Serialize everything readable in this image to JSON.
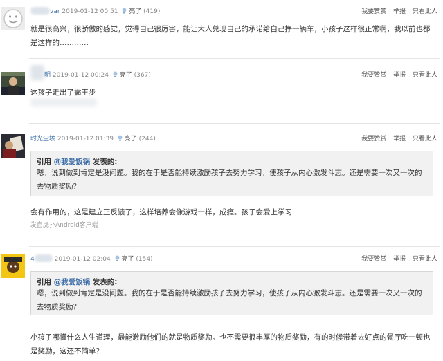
{
  "common": {
    "light_label": "亮了",
    "actions": [
      "我要赞赏",
      "举报",
      "只看此人"
    ],
    "quote_prefix": "引用 ",
    "quote_suffix": " 发表的:",
    "quote_ref_user": "@我爱饭锅"
  },
  "posts": [
    {
      "user": "var",
      "time": "2019-01-12 00:51",
      "likes": "(419)",
      "text": "就是很高兴，很骄傲的感觉，觉得自己很厉害，能让大人兑现自己的承诺给自己挣一辆车，小孩子这样很正常啊，我以前也都是这样的…………"
    },
    {
      "user": "明",
      "time": "2019-01-12 00:24",
      "likes": "(367)",
      "text": "这孩子走出了霸王步"
    },
    {
      "user": "时光尘埃",
      "time": "2019-01-12 01:39",
      "likes": "(244)",
      "quote_text": "嗯，说到做到肯定是没问题。我的在于是否能持续激励孩子去努力学习，使孩子从内心激发斗志。还是需要一次又一次的去物质奖励？",
      "text": "会有作用的，这是建立正反馈了，这样培养会像游戏一样，成瘾。孩子会爱上学习",
      "client": "发自虎扑Android客户端"
    },
    {
      "user": "4",
      "time": "2019-01-12 02:04",
      "likes": "(154)",
      "quote_text": "嗯，说到做到肯定是没问题。我的在于是否能持续激励孩子去努力学习，使孩子从内心激发斗志。还是需要一次又一次的去物质奖励？",
      "text": "小孩子哪懂什么人生道理，最能激励他们的就是物质奖励。也不需要很丰厚的物质奖励，有的时候带着去好点的餐厅吃一顿也是奖励，这还不简单？"
    }
  ]
}
